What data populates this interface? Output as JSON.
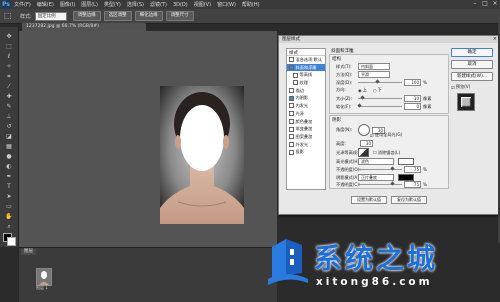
{
  "app": {
    "logo": "Ps"
  },
  "menu": [
    "文件(F)",
    "编辑(E)",
    "图像(I)",
    "图层(L)",
    "类型(Y)",
    "选择(S)",
    "滤镜(T)",
    "3D(D)",
    "视图(V)",
    "窗口(W)",
    "帮助(H)"
  ],
  "window_controls": [
    "–",
    "□",
    "×"
  ],
  "options_bar": {
    "label": "样式:",
    "field_value": "固定比例",
    "buttons": [
      "调整边缘",
      "选区调整",
      "细化边缘",
      "调整尺寸"
    ]
  },
  "document_tab": "1237282.jpg @ 66.7% (RGB/8#)",
  "dialog": {
    "title": "图层样式",
    "close": "×",
    "styles_header": "样式",
    "styles": [
      {
        "label": "混合选项:默认",
        "checked": false,
        "selected": false,
        "sub": false
      },
      {
        "label": "斜面和浮雕",
        "checked": true,
        "selected": true,
        "sub": false
      },
      {
        "label": "等高线",
        "checked": false,
        "selected": false,
        "sub": true
      },
      {
        "label": "纹理",
        "checked": false,
        "selected": false,
        "sub": true
      },
      {
        "label": "描边",
        "checked": false,
        "selected": false,
        "sub": false
      },
      {
        "label": "内阴影",
        "checked": true,
        "selected": false,
        "sub": false
      },
      {
        "label": "内发光",
        "checked": false,
        "selected": false,
        "sub": false
      },
      {
        "label": "光泽",
        "checked": false,
        "selected": false,
        "sub": false
      },
      {
        "label": "颜色叠加",
        "checked": false,
        "selected": false,
        "sub": false
      },
      {
        "label": "渐变叠加",
        "checked": false,
        "selected": false,
        "sub": false
      },
      {
        "label": "图案叠加",
        "checked": false,
        "selected": false,
        "sub": false
      },
      {
        "label": "外发光",
        "checked": false,
        "selected": false,
        "sub": false
      },
      {
        "label": "投影",
        "checked": false,
        "selected": false,
        "sub": false
      }
    ],
    "bevel": {
      "section_title": "斜面和浮雕",
      "structure_title": "结构",
      "style_label": "样式(T):",
      "style_value": "内斜面",
      "method_label": "方法(Q):",
      "method_value": "平滑",
      "depth_label": "深度(D):",
      "depth_value": "100",
      "direction_label": "方向:",
      "direction_up": "上",
      "direction_down": "下",
      "size_label": "大小(Z):",
      "size_value": "10",
      "soften_label": "软化(F):",
      "soften_value": "0",
      "unit_px": "像素",
      "unit_pct": "%"
    },
    "shading": {
      "title": "阴影",
      "angle_label": "角度(N):",
      "angle_value": "30",
      "global_light": "使用全局光(G)",
      "altitude_label": "高度:",
      "altitude_value": "30",
      "gloss_label": "光泽等高线:",
      "anti_alias": "消除锯齿(L)",
      "highlight_label": "高光模式(H):",
      "highlight_value": "滤色",
      "highlight_opacity": "75",
      "opacity_label": "不透明度(O):",
      "shadow_label": "阴影模式(A):",
      "shadow_value": "正片叠底",
      "shadow_opacity": "75",
      "opacity2_label": "不透明度(C):"
    },
    "bottom_buttons": [
      "设置为默认值",
      "复位为默认值"
    ],
    "right_buttons": [
      "确定",
      "取消",
      "新建样式(W)...",
      "预览(V)"
    ]
  },
  "layers": {
    "tab": "图层",
    "layer_label": "图层 1"
  },
  "watermark": {
    "title": "系统之城",
    "url": "xitong86.com"
  },
  "colors": {
    "accent": "#3b82d8",
    "watermark": "#1e6fd8"
  }
}
